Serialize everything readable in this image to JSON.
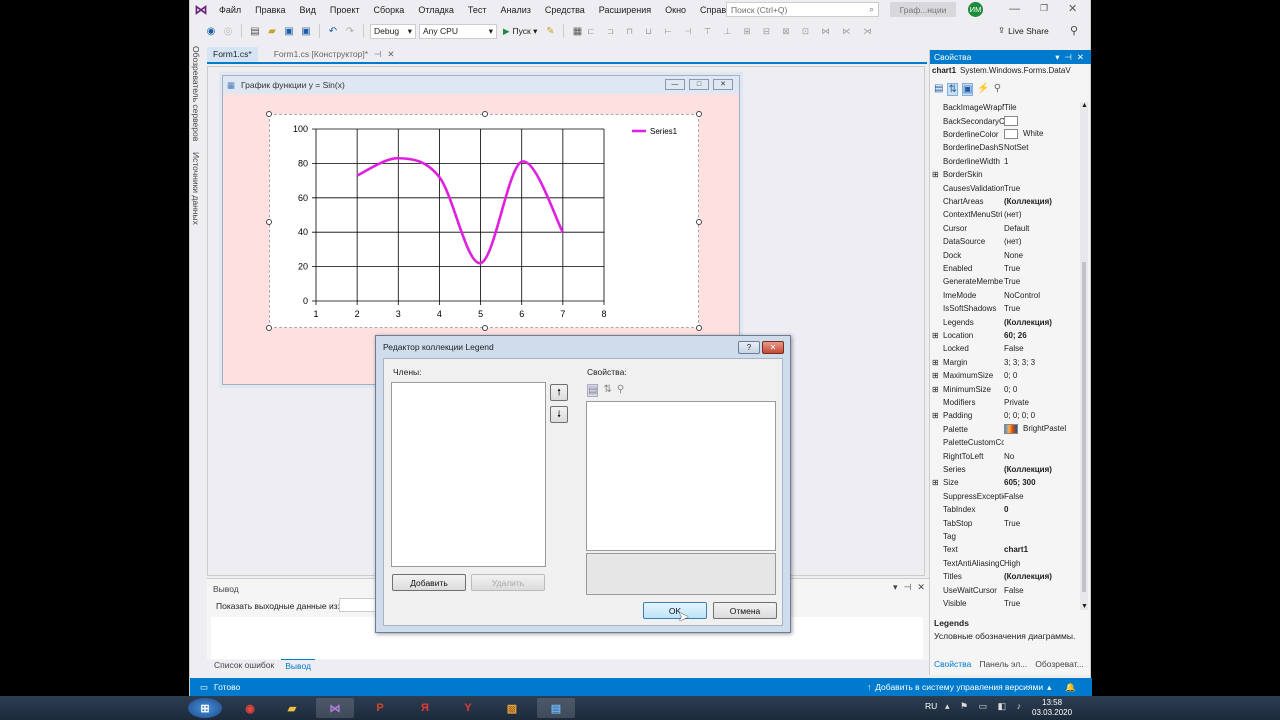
{
  "menu": [
    "Файл",
    "Правка",
    "Вид",
    "Проект",
    "Сборка",
    "Отладка",
    "Тест",
    "Анализ",
    "Средства",
    "Расширения",
    "Окно",
    "Справка"
  ],
  "search": {
    "placeholder": "Поиск (Ctrl+Q)"
  },
  "solution_title": "Граф...нции",
  "user_initials": "ИМ",
  "toolbar": {
    "config": "Debug",
    "platform": "Any CPU",
    "start_label": "Пуск",
    "live_share": "Live Share"
  },
  "left_tabs": [
    "Обозреватель серверов",
    "Источники данных"
  ],
  "doc_tabs": [
    "Form1.cs*",
    "Form1.cs [Конструктор]*"
  ],
  "form": {
    "title": "График функции y = Sin(x)"
  },
  "chart_data": {
    "type": "line",
    "title": "",
    "xlabel": "",
    "ylabel": "",
    "xlim": [
      1,
      8
    ],
    "ylim": [
      0,
      100
    ],
    "xticks": [
      1,
      2,
      3,
      4,
      5,
      6,
      7,
      8
    ],
    "yticks": [
      0,
      20,
      40,
      60,
      80,
      100
    ],
    "legend_position": "top-right",
    "grid": true,
    "series": [
      {
        "name": "Series1",
        "color": "#e020e0",
        "x": [
          2,
          3,
          4,
          5,
          6,
          7
        ],
        "y": [
          73,
          83,
          72,
          22,
          81,
          40
        ]
      }
    ]
  },
  "output": {
    "title": "Вывод",
    "show_label": "Показать выходные данные из:"
  },
  "bottom_tabs": [
    "Список ошибок",
    "Вывод"
  ],
  "properties": {
    "title": "Свойства",
    "object": "chart1",
    "object_type": "System.Windows.Forms.DataV",
    "rows": [
      {
        "name": "BackImageWrapM",
        "value": "Tile"
      },
      {
        "name": "BackSecondaryC",
        "value": ""
      },
      {
        "name": "BorderlineColor",
        "value": "White"
      },
      {
        "name": "BorderlineDashSt",
        "value": "NotSet"
      },
      {
        "name": "BorderlineWidth",
        "value": "1"
      },
      {
        "name": "BorderSkin",
        "value": "",
        "exp": true
      },
      {
        "name": "CausesValidation",
        "value": "True"
      },
      {
        "name": "ChartAreas",
        "value": "(Коллекция)",
        "bold": true
      },
      {
        "name": "ContextMenuStri",
        "value": "(нет)"
      },
      {
        "name": "Cursor",
        "value": "Default"
      },
      {
        "name": "DataSource",
        "value": "(нет)"
      },
      {
        "name": "Dock",
        "value": "None"
      },
      {
        "name": "Enabled",
        "value": "True"
      },
      {
        "name": "GenerateMembe",
        "value": "True"
      },
      {
        "name": "ImeMode",
        "value": "NoControl"
      },
      {
        "name": "IsSoftShadows",
        "value": "True"
      },
      {
        "name": "Legends",
        "value": "(Коллекция)",
        "bold": true
      },
      {
        "name": "Location",
        "value": "60; 26",
        "bold": true,
        "exp": true
      },
      {
        "name": "Locked",
        "value": "False"
      },
      {
        "name": "Margin",
        "value": "3; 3; 3; 3",
        "exp": true
      },
      {
        "name": "MaximumSize",
        "value": "0; 0",
        "exp": true
      },
      {
        "name": "MinimumSize",
        "value": "0; 0",
        "exp": true
      },
      {
        "name": "Modifiers",
        "value": "Private"
      },
      {
        "name": "Padding",
        "value": "0; 0; 0; 0",
        "exp": true
      },
      {
        "name": "Palette",
        "value": "BrightPastel"
      },
      {
        "name": "PaletteCustomCo",
        "value": ""
      },
      {
        "name": "RightToLeft",
        "value": "No"
      },
      {
        "name": "Series",
        "value": "(Коллекция)",
        "bold": true
      },
      {
        "name": "Size",
        "value": "605; 300",
        "bold": true,
        "exp": true
      },
      {
        "name": "SuppressExceptic",
        "value": "False"
      },
      {
        "name": "TabIndex",
        "value": "0",
        "bold": true
      },
      {
        "name": "TabStop",
        "value": "True"
      },
      {
        "name": "Tag",
        "value": ""
      },
      {
        "name": "Text",
        "value": "chart1",
        "bold": true
      },
      {
        "name": "TextAntiAliasingC",
        "value": "High"
      },
      {
        "name": "Titles",
        "value": "(Коллекция)",
        "bold": true
      },
      {
        "name": "UseWaitCursor",
        "value": "False"
      },
      {
        "name": "Visible",
        "value": "True"
      }
    ],
    "desc_title": "Legends",
    "desc_text": "Условные обозначения диаграммы.",
    "bottom_tabs": [
      "Свойства",
      "Панель эл...",
      "Обозреват..."
    ]
  },
  "dialog": {
    "title": "Редактор коллекции Legend",
    "members_label": "Члены:",
    "props_label": "Свойства:",
    "add": "Добавить",
    "remove": "Удалить",
    "ok": "OK",
    "cancel": "Отмена"
  },
  "status": {
    "left": "Готово",
    "right": "Добавить в систему управления версиями"
  },
  "tray": {
    "lang": "RU",
    "time": "13:58",
    "date": "03.03.2020"
  }
}
